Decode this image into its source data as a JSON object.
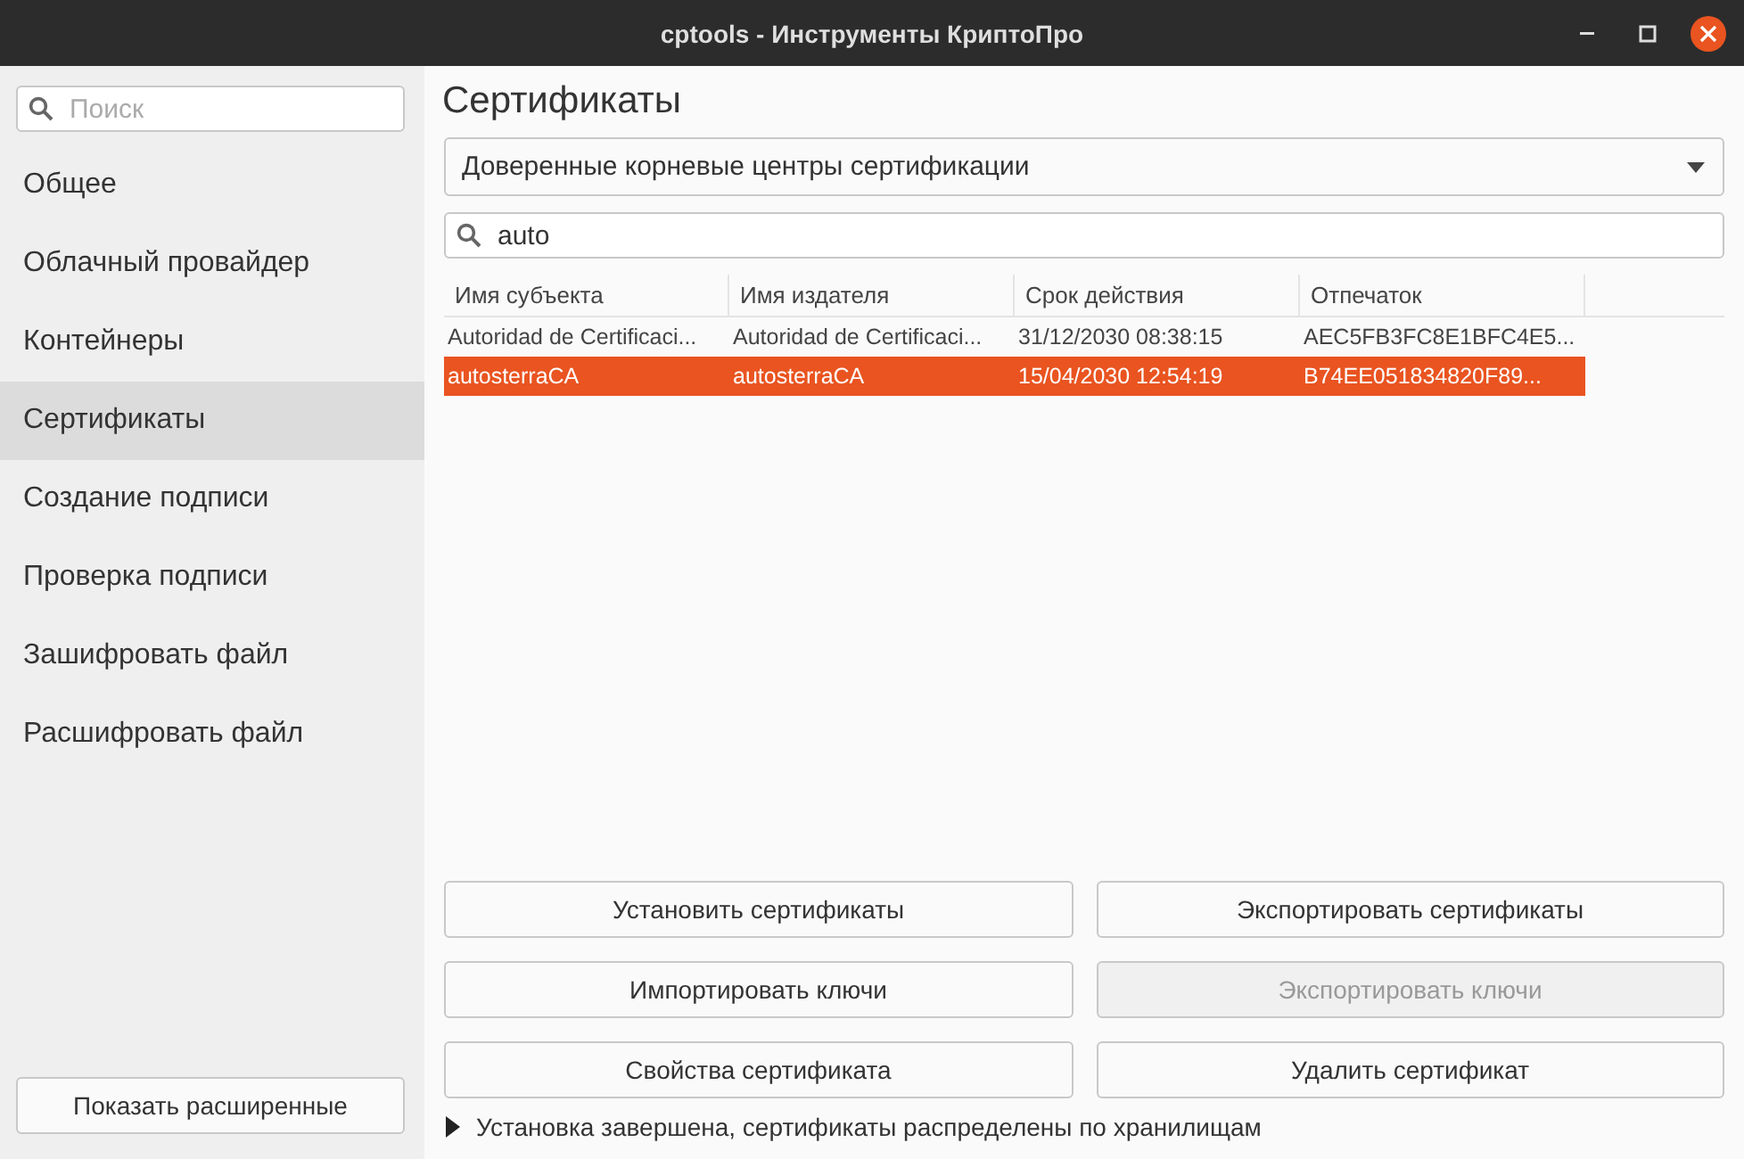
{
  "window": {
    "title": "cptools - Инструменты КриптоПро"
  },
  "sidebar": {
    "search": {
      "placeholder": "Поиск"
    },
    "items": [
      {
        "label": "Общее",
        "selected": false
      },
      {
        "label": "Облачный провайдер",
        "selected": false
      },
      {
        "label": "Контейнеры",
        "selected": false
      },
      {
        "label": "Сертификаты",
        "selected": true
      },
      {
        "label": "Создание подписи",
        "selected": false
      },
      {
        "label": "Проверка подписи",
        "selected": false
      },
      {
        "label": "Зашифровать файл",
        "selected": false
      },
      {
        "label": "Расшифровать файл",
        "selected": false
      }
    ],
    "button": "Показать расширенные"
  },
  "main": {
    "heading": "Сертификаты",
    "store": "Доверенные корневые центры сертификации",
    "filter": "auto",
    "table": {
      "columns": [
        "Имя субъекта",
        "Имя издателя",
        "Срок действия",
        "Отпечаток"
      ],
      "rows": [
        {
          "cells": [
            "Autoridad de Certificaci...",
            "Autoridad de Certificaci...",
            "31/12/2030 08:38:15",
            "AEC5FB3FC8E1BFC4E5..."
          ],
          "selected": false
        },
        {
          "cells": [
            "autosterraCA",
            "autosterraCA",
            "15/04/2030 12:54:19",
            "B74EE051834820F89..."
          ],
          "selected": true
        }
      ]
    },
    "buttons": [
      {
        "label": "Установить сертификаты",
        "disabled": false
      },
      {
        "label": "Экспортировать сертификаты",
        "disabled": false
      },
      {
        "label": "Импортировать ключи",
        "disabled": false
      },
      {
        "label": "Экспортировать ключи",
        "disabled": true
      },
      {
        "label": "Свойства сертификата",
        "disabled": false
      },
      {
        "label": "Удалить сертификат",
        "disabled": false
      }
    ],
    "status": {
      "text": "Установка завершена, сертификаты распределены по хранилищам",
      "expanded": false
    }
  }
}
